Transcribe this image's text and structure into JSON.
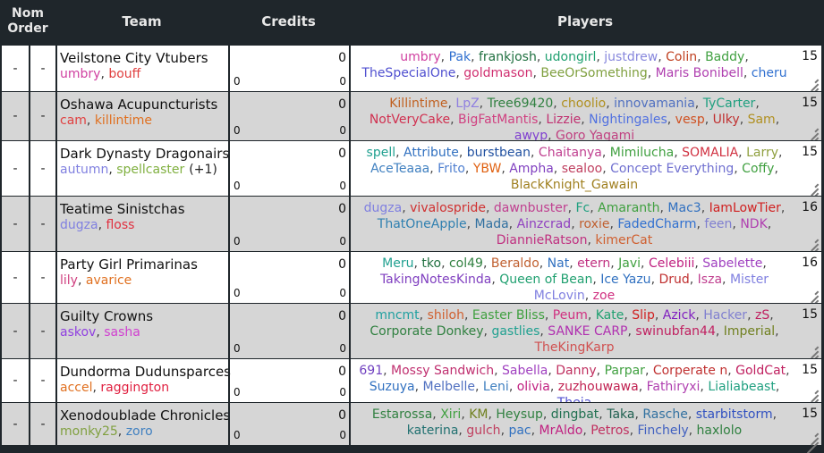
{
  "header": {
    "nom_order": "Nom\nOrder",
    "team": "Team",
    "credits": "Credits",
    "players": "Players"
  },
  "rows": [
    {
      "nom": "-",
      "order": "-",
      "team": "Veilstone City Vtubers",
      "captains": [
        {
          "name": "umbry",
          "color": "#d040a0"
        },
        {
          "name": "bouff",
          "color": "#e04040"
        }
      ],
      "extra": "",
      "credit_left": "0",
      "credit_right_top": "0",
      "credit_right_bottom": "0",
      "count": "15",
      "players": [
        {
          "name": "umbry",
          "color": "#d040a0"
        },
        {
          "name": "Pak",
          "color": "#3070d0"
        },
        {
          "name": "frankjosh",
          "color": "#207040"
        },
        {
          "name": "udongirl",
          "color": "#20a070"
        },
        {
          "name": "justdrew",
          "color": "#8888dd"
        },
        {
          "name": "Colin",
          "color": "#c04020"
        },
        {
          "name": "Baddy",
          "color": "#40a040"
        },
        {
          "name": "TheSpecialOne",
          "color": "#5050d0"
        },
        {
          "name": "goldmason",
          "color": "#d03070"
        },
        {
          "name": "BeeOrSomething",
          "color": "#80a040"
        },
        {
          "name": "Maris Bonibell",
          "color": "#b040b0"
        },
        {
          "name": "cheru",
          "color": "#3070d0"
        }
      ]
    },
    {
      "nom": "-",
      "order": "-",
      "team": "Oshawa Acupuncturists",
      "captains": [
        {
          "name": "cam",
          "color": "#e04040"
        },
        {
          "name": "killintime",
          "color": "#e07020"
        }
      ],
      "extra": "",
      "credit_left": "0",
      "credit_right_top": "0",
      "credit_right_bottom": "0",
      "count": "15",
      "players": [
        {
          "name": "Killintime",
          "color": "#c06020"
        },
        {
          "name": "LpZ",
          "color": "#9080e0"
        },
        {
          "name": "Tree69420",
          "color": "#308040"
        },
        {
          "name": "choolio",
          "color": "#b09020"
        },
        {
          "name": "innovamania",
          "color": "#5070c0"
        },
        {
          "name": "TyCarter",
          "color": "#20a080"
        },
        {
          "name": "NotVeryCake",
          "color": "#d03050"
        },
        {
          "name": "BigFatMantis",
          "color": "#d04080"
        },
        {
          "name": "Lizzie",
          "color": "#c03070"
        },
        {
          "name": "Nightingales",
          "color": "#5070e0"
        },
        {
          "name": "vesp",
          "color": "#d05020"
        },
        {
          "name": "Ulky",
          "color": "#c03030"
        },
        {
          "name": "Sam",
          "color": "#b09020"
        },
        {
          "name": "awyp",
          "color": "#8040d0"
        },
        {
          "name": "Goro Yagami",
          "color": "#c04080"
        }
      ]
    },
    {
      "nom": "-",
      "order": "-",
      "team": "Dark Dynasty Dragonairs",
      "captains": [
        {
          "name": "autumn",
          "color": "#8080e0"
        },
        {
          "name": "spellcaster",
          "color": "#80b040"
        }
      ],
      "extra": "(+1)",
      "credit_left": "0",
      "credit_right_top": "0",
      "credit_right_bottom": "0",
      "count": "15",
      "players": [
        {
          "name": "spell",
          "color": "#20a090"
        },
        {
          "name": "Attribute",
          "color": "#3070c0"
        },
        {
          "name": "burstbean",
          "color": "#2050a0"
        },
        {
          "name": "Chaitanya",
          "color": "#c04090"
        },
        {
          "name": "Mimilucha",
          "color": "#40a040"
        },
        {
          "name": "SOMALIA",
          "color": "#d03040"
        },
        {
          "name": "Larry",
          "color": "#90a040"
        },
        {
          "name": "AceTeaaa",
          "color": "#4080c0"
        },
        {
          "name": "Frito",
          "color": "#5080d0"
        },
        {
          "name": "YBW",
          "color": "#e06010"
        },
        {
          "name": "Ampha",
          "color": "#8040c0"
        },
        {
          "name": "sealoo",
          "color": "#c04060"
        },
        {
          "name": "Concept Everything",
          "color": "#7070d0"
        },
        {
          "name": "Coffy",
          "color": "#40a040"
        },
        {
          "name": "BlackKnight_Gawain",
          "color": "#a08020"
        }
      ]
    },
    {
      "nom": "-",
      "order": "-",
      "team": "Teatime Sinistchas",
      "captains": [
        {
          "name": "dugza",
          "color": "#8080e0"
        },
        {
          "name": "floss",
          "color": "#e03040"
        }
      ],
      "extra": "",
      "credit_left": "0",
      "credit_right_top": "0",
      "credit_right_bottom": "0",
      "count": "16",
      "players": [
        {
          "name": "dugza",
          "color": "#8080e0"
        },
        {
          "name": "vivalospride",
          "color": "#d03030"
        },
        {
          "name": "dawnbuster",
          "color": "#c04090"
        },
        {
          "name": "Fc",
          "color": "#20a080"
        },
        {
          "name": "Amaranth",
          "color": "#40a040"
        },
        {
          "name": "Mac3",
          "color": "#3070c0"
        },
        {
          "name": "IamLowTier",
          "color": "#d02020"
        },
        {
          "name": "ThatOneApple",
          "color": "#3080b0"
        },
        {
          "name": "Mada",
          "color": "#3070a0"
        },
        {
          "name": "Ainzcrad",
          "color": "#9040c0"
        },
        {
          "name": "roxie",
          "color": "#c06030"
        },
        {
          "name": "FadedCharm",
          "color": "#3070d0"
        },
        {
          "name": "feen",
          "color": "#8080d0"
        },
        {
          "name": "NDK",
          "color": "#b040b0"
        },
        {
          "name": "DiannieRatson",
          "color": "#c03080"
        },
        {
          "name": "kimerCat",
          "color": "#d06030"
        }
      ]
    },
    {
      "nom": "-",
      "order": "-",
      "team": "Party Girl Primarinas",
      "captains": [
        {
          "name": "lily",
          "color": "#d04080"
        },
        {
          "name": "avarice",
          "color": "#e07020"
        }
      ],
      "extra": "",
      "credit_left": "0",
      "credit_right_top": "0",
      "credit_right_bottom": "0",
      "count": "16",
      "players": [
        {
          "name": "Meru",
          "color": "#20a090"
        },
        {
          "name": "tko",
          "color": "#207040"
        },
        {
          "name": "col49",
          "color": "#308040"
        },
        {
          "name": "Beraldo",
          "color": "#c06030"
        },
        {
          "name": "Nat",
          "color": "#3070c0"
        },
        {
          "name": "etern",
          "color": "#c03080"
        },
        {
          "name": "Javi",
          "color": "#40a040"
        },
        {
          "name": "Celebiii",
          "color": "#c02080"
        },
        {
          "name": "Sabelette",
          "color": "#a040c0"
        },
        {
          "name": "TakingNotesKinda",
          "color": "#8040c0"
        },
        {
          "name": "Queen of Bean",
          "color": "#20a070"
        },
        {
          "name": "Ice Yazu",
          "color": "#3070c0"
        },
        {
          "name": "Drud",
          "color": "#c03030"
        },
        {
          "name": "Isza",
          "color": "#c04090"
        },
        {
          "name": "Mister McLovin",
          "color": "#8080e0"
        },
        {
          "name": "zoe",
          "color": "#d03080"
        }
      ]
    },
    {
      "nom": "-",
      "order": "-",
      "team": "Guilty Crowns",
      "captains": [
        {
          "name": "askov",
          "color": "#9040e0"
        },
        {
          "name": "sasha",
          "color": "#d040d0"
        }
      ],
      "extra": "",
      "credit_left": "0",
      "credit_right_top": "0",
      "credit_right_bottom": "0",
      "count": "15",
      "players": [
        {
          "name": "mncmt",
          "color": "#20a0a0"
        },
        {
          "name": "shiloh",
          "color": "#d06030"
        },
        {
          "name": "Easter Bliss",
          "color": "#40a040"
        },
        {
          "name": "Peum",
          "color": "#d03080"
        },
        {
          "name": "Kate",
          "color": "#20a070"
        },
        {
          "name": "Slip",
          "color": "#d02020"
        },
        {
          "name": "Azick",
          "color": "#8020c0"
        },
        {
          "name": "Hacker",
          "color": "#8080d0"
        },
        {
          "name": "zS",
          "color": "#c02060"
        },
        {
          "name": "Corporate Donkey",
          "color": "#308040"
        },
        {
          "name": "gastlies",
          "color": "#20a090"
        },
        {
          "name": "SANKE CARP",
          "color": "#b030b0"
        },
        {
          "name": "swinubfan44",
          "color": "#c02060"
        },
        {
          "name": "Imperial",
          "color": "#708020"
        },
        {
          "name": "TheKingKarp",
          "color": "#d05050"
        }
      ]
    },
    {
      "nom": "-",
      "order": "-",
      "team": "Dundorma Dudunsparces",
      "captains": [
        {
          "name": "accel",
          "color": "#e07020"
        },
        {
          "name": "raggington",
          "color": "#e02040"
        }
      ],
      "extra": "",
      "credit_left": "0",
      "credit_right_top": "0",
      "credit_right_bottom": "0",
      "count": "15",
      "players": [
        {
          "name": "691",
          "color": "#7040c0"
        },
        {
          "name": "Mossy Sandwich",
          "color": "#c03070"
        },
        {
          "name": "Sabella",
          "color": "#a040c0"
        },
        {
          "name": "Danny",
          "color": "#c03060"
        },
        {
          "name": "Parpar",
          "color": "#40a040"
        },
        {
          "name": "Corperate n",
          "color": "#c03030"
        },
        {
          "name": "GoldCat",
          "color": "#c02060"
        },
        {
          "name": "Suzuya",
          "color": "#3070c0"
        },
        {
          "name": "Melbelle",
          "color": "#5070c0"
        },
        {
          "name": "Leni",
          "color": "#4080c0"
        },
        {
          "name": "olivia",
          "color": "#c02080"
        },
        {
          "name": "zuzhouwawa",
          "color": "#c02050"
        },
        {
          "name": "Fathiryxi",
          "color": "#b040b0"
        },
        {
          "name": "Lialiabeast",
          "color": "#20a080"
        },
        {
          "name": "Theia",
          "color": "#5050d0"
        }
      ]
    },
    {
      "nom": "-",
      "order": "-",
      "team": "Xenodoublade Chronicles",
      "captains": [
        {
          "name": "monky25",
          "color": "#80a040"
        },
        {
          "name": "zoro",
          "color": "#4080c0"
        }
      ],
      "extra": "",
      "credit_left": "0",
      "credit_right_top": "0",
      "credit_right_bottom": "0",
      "count": "15",
      "players": [
        {
          "name": "Estarossa",
          "color": "#308040"
        },
        {
          "name": "Xiri",
          "color": "#40a040"
        },
        {
          "name": "KM",
          "color": "#708020"
        },
        {
          "name": "Heysup",
          "color": "#308040"
        },
        {
          "name": "dingbat",
          "color": "#207050"
        },
        {
          "name": "Taka",
          "color": "#206050"
        },
        {
          "name": "Rasche",
          "color": "#3070a0"
        },
        {
          "name": "starbitstorm",
          "color": "#3050c0"
        },
        {
          "name": "katerina",
          "color": "#207070"
        },
        {
          "name": "gulch",
          "color": "#c04060"
        },
        {
          "name": "pac",
          "color": "#3070c0"
        },
        {
          "name": "MrAldo",
          "color": "#c02080"
        },
        {
          "name": "Petros",
          "color": "#c03060"
        },
        {
          "name": "Finchely",
          "color": "#4060c0"
        },
        {
          "name": "haxlolo",
          "color": "#308040"
        }
      ]
    }
  ]
}
